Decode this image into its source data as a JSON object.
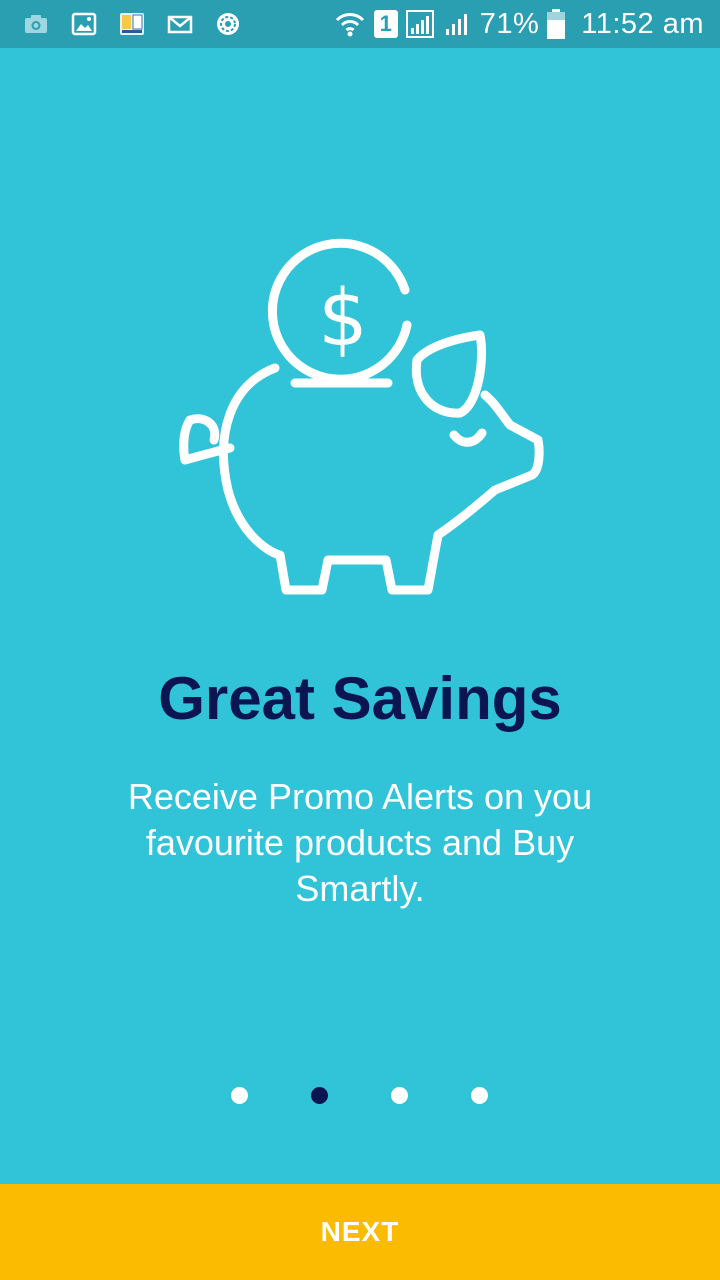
{
  "status_bar": {
    "battery": "71%",
    "time": "11:52 am",
    "network_badge": "1",
    "left_icons": [
      "camera-icon",
      "gallery-icon",
      "dictionary-app-icon",
      "mail-icon",
      "settings-badge-icon"
    ]
  },
  "onboarding": {
    "illustration": "piggy-bank-with-dollar-coin",
    "title": "Great Savings",
    "description": "Receive Promo Alerts on you favourite products and Buy Smartly.",
    "current_page": 2,
    "total_pages": 4
  },
  "footer": {
    "next_label": "NEXT"
  },
  "colors": {
    "background": "#31C4D8",
    "status_bar": "#2A9FB1",
    "title": "#0B1552",
    "dot_active": "#0B1552",
    "dot_inactive": "#FFFFFF",
    "next_bar": "#FABB00"
  }
}
